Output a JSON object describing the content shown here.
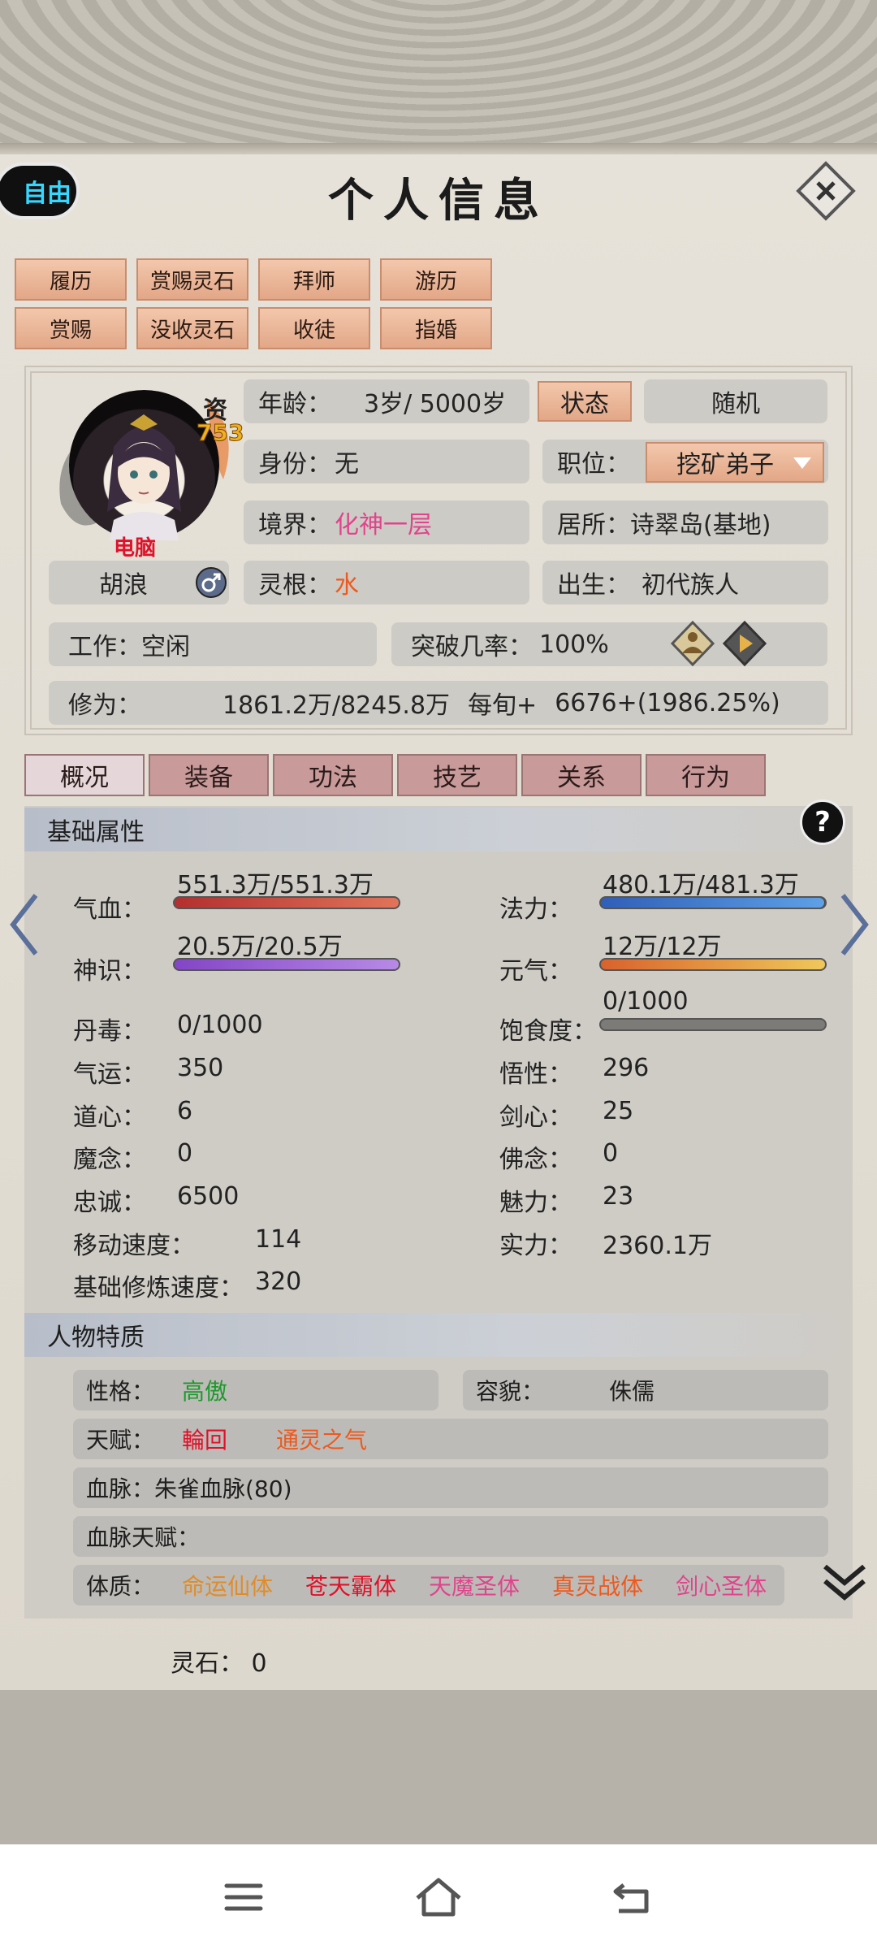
{
  "header": {
    "title": "个人信息",
    "free_label": "自由"
  },
  "action_buttons": [
    "履历",
    "赏赐灵石",
    "拜师",
    "游历",
    "赏赐",
    "没收灵石",
    "收徒",
    "指婚"
  ],
  "profile": {
    "aptitude_label": "资",
    "aptitude_value": "753",
    "avatar_tag": "电脑",
    "name": "胡浪",
    "age_label": "年龄：",
    "age_value": "3岁/ 5000岁",
    "status_button": "状态",
    "random_button": "随机",
    "identity_label": "身份：",
    "identity_value": "无",
    "position_label": "职位：",
    "position_value": "挖矿弟子",
    "realm_label": "境界：",
    "realm_value": "化神一层",
    "residence_label": "居所：",
    "residence_value": "诗翠岛(基地)",
    "root_label": "灵根：",
    "root_value": "水",
    "birth_label": "出生：",
    "birth_value": "初代族人",
    "work_label": "工作：",
    "work_value": "空闲",
    "breakthrough_label": "突破几率：",
    "breakthrough_value": "100%",
    "cultivation_label": "修为：",
    "cultivation_value": "1861.2万/8245.8万",
    "per_round_label": "每旬+",
    "per_round_value": "6676+(1986.25%)"
  },
  "tabs": [
    "概况",
    "装备",
    "功法",
    "技艺",
    "关系",
    "行为"
  ],
  "basic": {
    "section_title": "基础属性",
    "help": "?",
    "blood_label": "气血：",
    "blood_value": "551.3万/551.3万",
    "blood_fill": 1.0,
    "mana_label": "法力：",
    "mana_value": "480.1万/481.3万",
    "mana_fill": 0.9975,
    "spirit_label": "神识：",
    "spirit_value": "20.5万/20.5万",
    "spirit_fill": 1.0,
    "vigor_label": "元气：",
    "vigor_value": "12万/12万",
    "vigor_fill": 1.0,
    "satiety_label": "饱食度：",
    "satiety_value": "0/1000",
    "satiety_fill": 0.0,
    "rows_left": [
      {
        "label": "丹毒：",
        "value": "0/1000"
      },
      {
        "label": "气运：",
        "value": "350"
      },
      {
        "label": "道心：",
        "value": "6"
      },
      {
        "label": "魔念：",
        "value": "0"
      },
      {
        "label": "忠诚：",
        "value": "6500"
      },
      {
        "label": "移动速度：",
        "value": "114"
      },
      {
        "label": "基础修炼速度：",
        "value": "320"
      }
    ],
    "rows_right": [
      {
        "label": "悟性：",
        "value": "296"
      },
      {
        "label": "剑心：",
        "value": "25"
      },
      {
        "label": "佛念：",
        "value": "0"
      },
      {
        "label": "魅力：",
        "value": "23"
      },
      {
        "label": "实力：",
        "value": "2360.1万"
      }
    ]
  },
  "traits": {
    "section_title": "人物特质",
    "personality_label": "性格：",
    "personality_value": "高傲",
    "appearance_label": "容貌：",
    "appearance_value": "侏儒",
    "talent_label": "天赋：",
    "talent_1": "輪回",
    "talent_2": "通灵之气",
    "bloodline_label": "血脉：",
    "bloodline_value": "朱雀血脉(80)",
    "bloodline_talent_label": "血脉天赋：",
    "physique_label": "体质：",
    "physique": [
      "命运仙体",
      "苍天霸体",
      "天魔圣体",
      "真灵战体",
      "剑心圣体"
    ]
  },
  "footer": {
    "spirit_stone_label": "灵石：",
    "spirit_stone_value": "0"
  },
  "colors": {
    "accent": "#e2a787",
    "blood": "#c8463e",
    "mana": "#3f73c9",
    "spirit": "#9a62d2",
    "vigor": "#e0a038"
  }
}
